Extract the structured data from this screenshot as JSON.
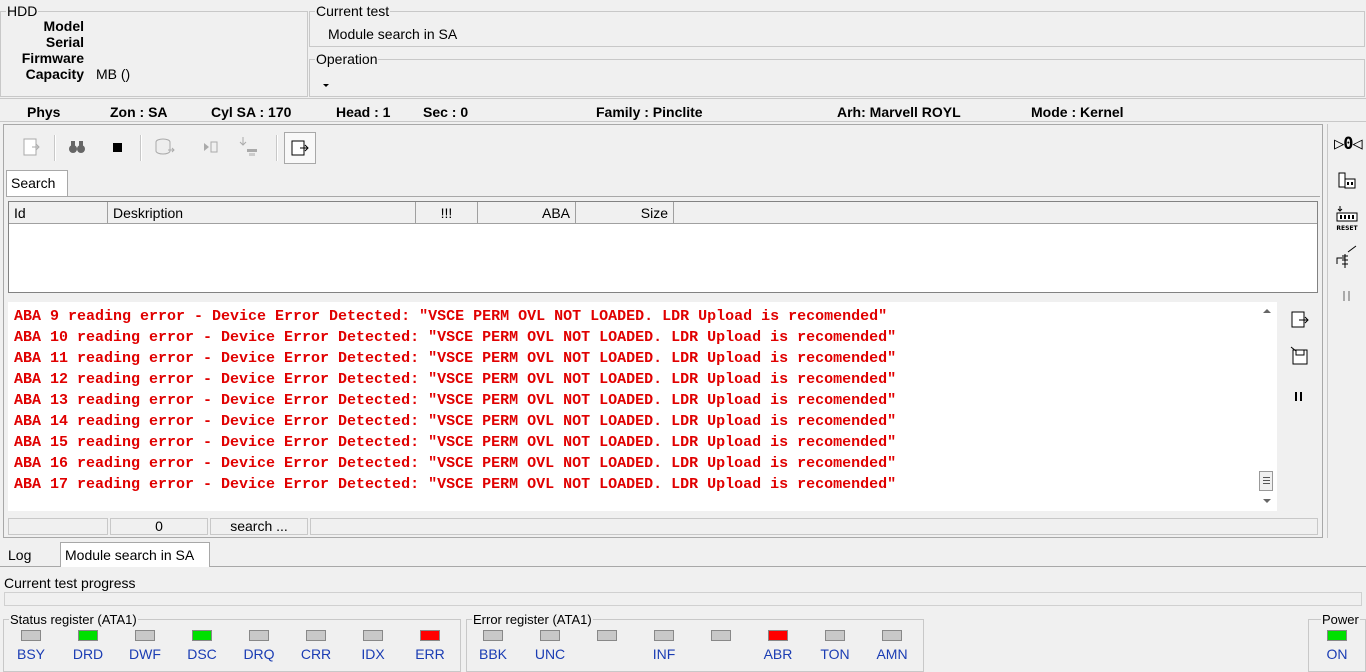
{
  "hdd": {
    "legend": "HDD",
    "model_label": "Model",
    "serial_label": "Serial",
    "firmware_label": "Firmware",
    "capacity_label": "Capacity",
    "capacity_value": "MB ()"
  },
  "current_test": {
    "legend": "Current test",
    "value": "Module search in SA"
  },
  "operation": {
    "legend": "Operation",
    "value": ""
  },
  "info_bar": {
    "phys": "Phys",
    "zone": "Zon : SA",
    "cyl": "Cyl SA : 170",
    "head": "Head : 1",
    "sec": "Sec : 0",
    "family": "Family : Pinclite",
    "arch": "Arh: Marvell ROYL",
    "mode": "Mode : Kernel"
  },
  "toolbar": {
    "icons": [
      "open-module-icon",
      "binoculars-icon",
      "stop-icon",
      "read-disk-icon",
      "step-icon",
      "load-icon",
      "export-icon"
    ]
  },
  "search_tab": {
    "label": "Search"
  },
  "table": {
    "columns": [
      "Id",
      "Deskription",
      "!!!",
      "ABA",
      "Size"
    ],
    "rows": []
  },
  "log": {
    "lines": [
      "ABA 9 reading error - Device Error Detected: \"VSCE PERM OVL NOT LOADED. LDR Upload is recomended\"",
      "ABA 10 reading error - Device Error Detected: \"VSCE PERM OVL NOT LOADED. LDR Upload is recomended\"",
      "ABA 11 reading error - Device Error Detected: \"VSCE PERM OVL NOT LOADED. LDR Upload is recomended\"",
      "ABA 12 reading error - Device Error Detected: \"VSCE PERM OVL NOT LOADED. LDR Upload is recomended\"",
      "ABA 13 reading error - Device Error Detected: \"VSCE PERM OVL NOT LOADED. LDR Upload is recomended\"",
      "ABA 14 reading error - Device Error Detected: \"VSCE PERM OVL NOT LOADED. LDR Upload is recomended\"",
      "ABA 15 reading error - Device Error Detected: \"VSCE PERM OVL NOT LOADED. LDR Upload is recomended\"",
      "ABA 16 reading error - Device Error Detected: \"VSCE PERM OVL NOT LOADED. LDR Upload is recomended\"",
      "ABA 17 reading error - Device Error Detected: \"VSCE PERM OVL NOT LOADED. LDR Upload is recomended\""
    ],
    "color": "#e00000"
  },
  "status_strip": {
    "cell1": "",
    "count": "0",
    "status": "search ..."
  },
  "bottom_tabs": {
    "log": "Log",
    "module": "Module search in SA"
  },
  "progress": {
    "label": "Current test progress",
    "value": 0
  },
  "status_register": {
    "legend": "Status register (ATA1)",
    "leds": [
      {
        "label": "BSY",
        "color": "#c8c8c8"
      },
      {
        "label": "DRD",
        "color": "#00e000"
      },
      {
        "label": "DWF",
        "color": "#c8c8c8"
      },
      {
        "label": "DSC",
        "color": "#00e000"
      },
      {
        "label": "DRQ",
        "color": "#c8c8c8"
      },
      {
        "label": "CRR",
        "color": "#c8c8c8"
      },
      {
        "label": "IDX",
        "color": "#c8c8c8"
      },
      {
        "label": "ERR",
        "color": "#ff0000"
      }
    ]
  },
  "error_register": {
    "legend": "Error register (ATA1)",
    "leds": [
      {
        "label": "BBK",
        "color": "#c8c8c8"
      },
      {
        "label": "UNC",
        "color": "#c8c8c8"
      },
      {
        "label": "",
        "color": "#c8c8c8"
      },
      {
        "label": "INF",
        "color": "#c8c8c8"
      },
      {
        "label": "",
        "color": "#c8c8c8"
      },
      {
        "label": "ABR",
        "color": "#ff0000"
      },
      {
        "label": "TON",
        "color": "#c8c8c8"
      },
      {
        "label": "AMN",
        "color": "#c8c8c8"
      }
    ]
  },
  "power": {
    "legend": "Power",
    "label": "ON",
    "color": "#00e000"
  }
}
